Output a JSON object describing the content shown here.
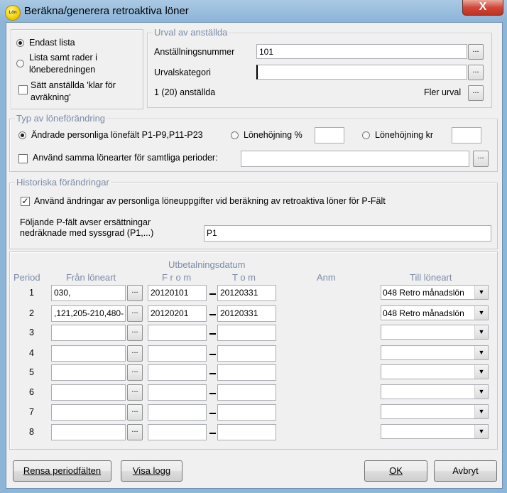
{
  "window": {
    "title": "Beräkna/generera retroaktiva löner",
    "icon_label": "Lön",
    "close_label": "X"
  },
  "mode": {
    "options": [
      {
        "label": "Endast lista",
        "selected": true
      },
      {
        "label": "Lista samt rader i\nlöneberedningen",
        "selected": false
      }
    ],
    "mark_ready_label": "Sätt anställda 'klar för\navräkning'",
    "mark_ready_checked": false
  },
  "selection": {
    "title": "Urval av anställda",
    "employee_number_label": "Anställningsnummer",
    "employee_number_value": "101",
    "category_label": "Urvalskategori",
    "category_value": "",
    "count_text": "1 (20) anställda",
    "more_label": "Fler urval",
    "ellipsis": "..."
  },
  "change_type": {
    "title": "Typ av löneförändring",
    "options": [
      {
        "label": "Ändrade personliga lönefält P1-P9,P11-P23",
        "selected": true
      },
      {
        "label": "Lönehöjning %",
        "selected": false
      },
      {
        "label": "Lönehöjning kr",
        "selected": false
      }
    ],
    "percent_value": "",
    "kr_value": "",
    "same_types_label": "Använd samma lönearter för samtliga perioder:",
    "same_types_checked": false,
    "same_types_value": ""
  },
  "history": {
    "title": "Historiska förändringar",
    "use_changes_label": "Använd ändringar av personliga löneuppgifter vid beräkning av retroaktiva löner för P-Fält",
    "use_changes_checked": true,
    "pfield_label": "Följande P-fält avser ersättningar\nnedräknade med syssgrad (P1,...)",
    "pfield_value": "P1"
  },
  "periods": {
    "headers": {
      "payment_date": "Utbetalningsdatum",
      "period": "Period",
      "from_type": "Från löneart",
      "from": "F r o m",
      "to": "T o m",
      "note": "Anm",
      "to_type": "Till löneart"
    },
    "rows": [
      {
        "period": "1",
        "from_type": "030,",
        "from": "20120101",
        "to": "20120331",
        "to_type": "048 Retro månadslön"
      },
      {
        "period": "2",
        "from_type": ",121,205-210,480-",
        "from": "20120201",
        "to": "20120331",
        "to_type": "048 Retro månadslön"
      },
      {
        "period": "3",
        "from_type": "",
        "from": "",
        "to": "",
        "to_type": ""
      },
      {
        "period": "4",
        "from_type": "",
        "from": "",
        "to": "",
        "to_type": ""
      },
      {
        "period": "5",
        "from_type": "",
        "from": "",
        "to": "",
        "to_type": ""
      },
      {
        "period": "6",
        "from_type": "",
        "from": "",
        "to": "",
        "to_type": ""
      },
      {
        "period": "7",
        "from_type": "",
        "from": "",
        "to": "",
        "to_type": ""
      },
      {
        "period": "8",
        "from_type": "",
        "from": "",
        "to": "",
        "to_type": ""
      }
    ]
  },
  "buttons": {
    "clear_periods": "Rensa periodfälten",
    "show_log": "Visa logg",
    "ok": "OK",
    "cancel": "Avbryt"
  }
}
